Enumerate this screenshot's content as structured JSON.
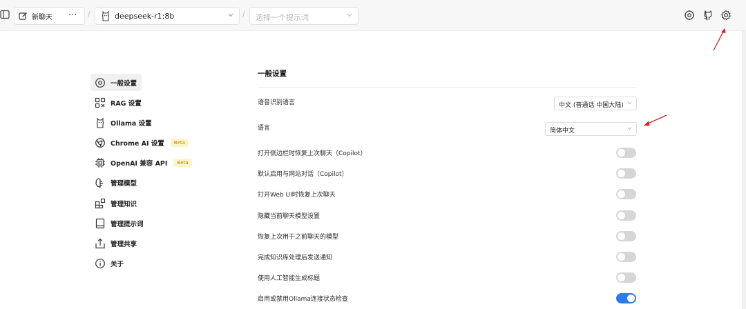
{
  "topbar": {
    "new_chat": "新聊天",
    "more": "···",
    "separator": "/",
    "model": "deepseek-r1:8b",
    "prompt_placeholder": "选择一个提示词"
  },
  "nav": [
    {
      "label": "一般设置",
      "icon": "settings-outline-icon",
      "active": true
    },
    {
      "label": "RAG 设置",
      "icon": "rag-blocks-icon"
    },
    {
      "label": "Ollama 设置",
      "icon": "llama-icon"
    },
    {
      "label": "Chrome AI 设置",
      "icon": "chrome-icon",
      "badge": "Beta"
    },
    {
      "label": "OpenAI 兼容 API",
      "icon": "cpu-icon",
      "badge": "Beta"
    },
    {
      "label": "管理模型",
      "icon": "brain-icon"
    },
    {
      "label": "管理知识",
      "icon": "blocks-icon"
    },
    {
      "label": "管理提示词",
      "icon": "book-icon"
    },
    {
      "label": "管理共享",
      "icon": "share-icon"
    },
    {
      "label": "关于",
      "icon": "info-icon"
    }
  ],
  "section": {
    "title": "一般设置",
    "speech_lang_label": "语音识别语言",
    "speech_lang_value": "中文 (普通话 中国大陆)",
    "lang_label": "语言",
    "lang_value": "简体中文",
    "toggles": [
      {
        "label": "打开侧边栏时恢复上次聊天（Copilot）",
        "on": false
      },
      {
        "label": "默认启用与网站对话（Copilot）",
        "on": false
      },
      {
        "label": "打开Web UI时恢复上次聊天",
        "on": false
      },
      {
        "label": "隐藏当前聊天模型设置",
        "on": false
      },
      {
        "label": "恢复上次用于之前聊天的模型",
        "on": false
      },
      {
        "label": "完成知识库处理后发送通知",
        "on": false
      },
      {
        "label": "使用人工智能生成标题",
        "on": false
      },
      {
        "label": "启用或禁用Ollama连接状态检查",
        "on": true
      }
    ]
  },
  "colors": {
    "toggle_on": "#2f7bea",
    "toggle_off": "#d6d6d6",
    "beta_bg": "#fdf5c9",
    "beta_text": "#b58a12",
    "annotation_arrow": "#d62020"
  }
}
